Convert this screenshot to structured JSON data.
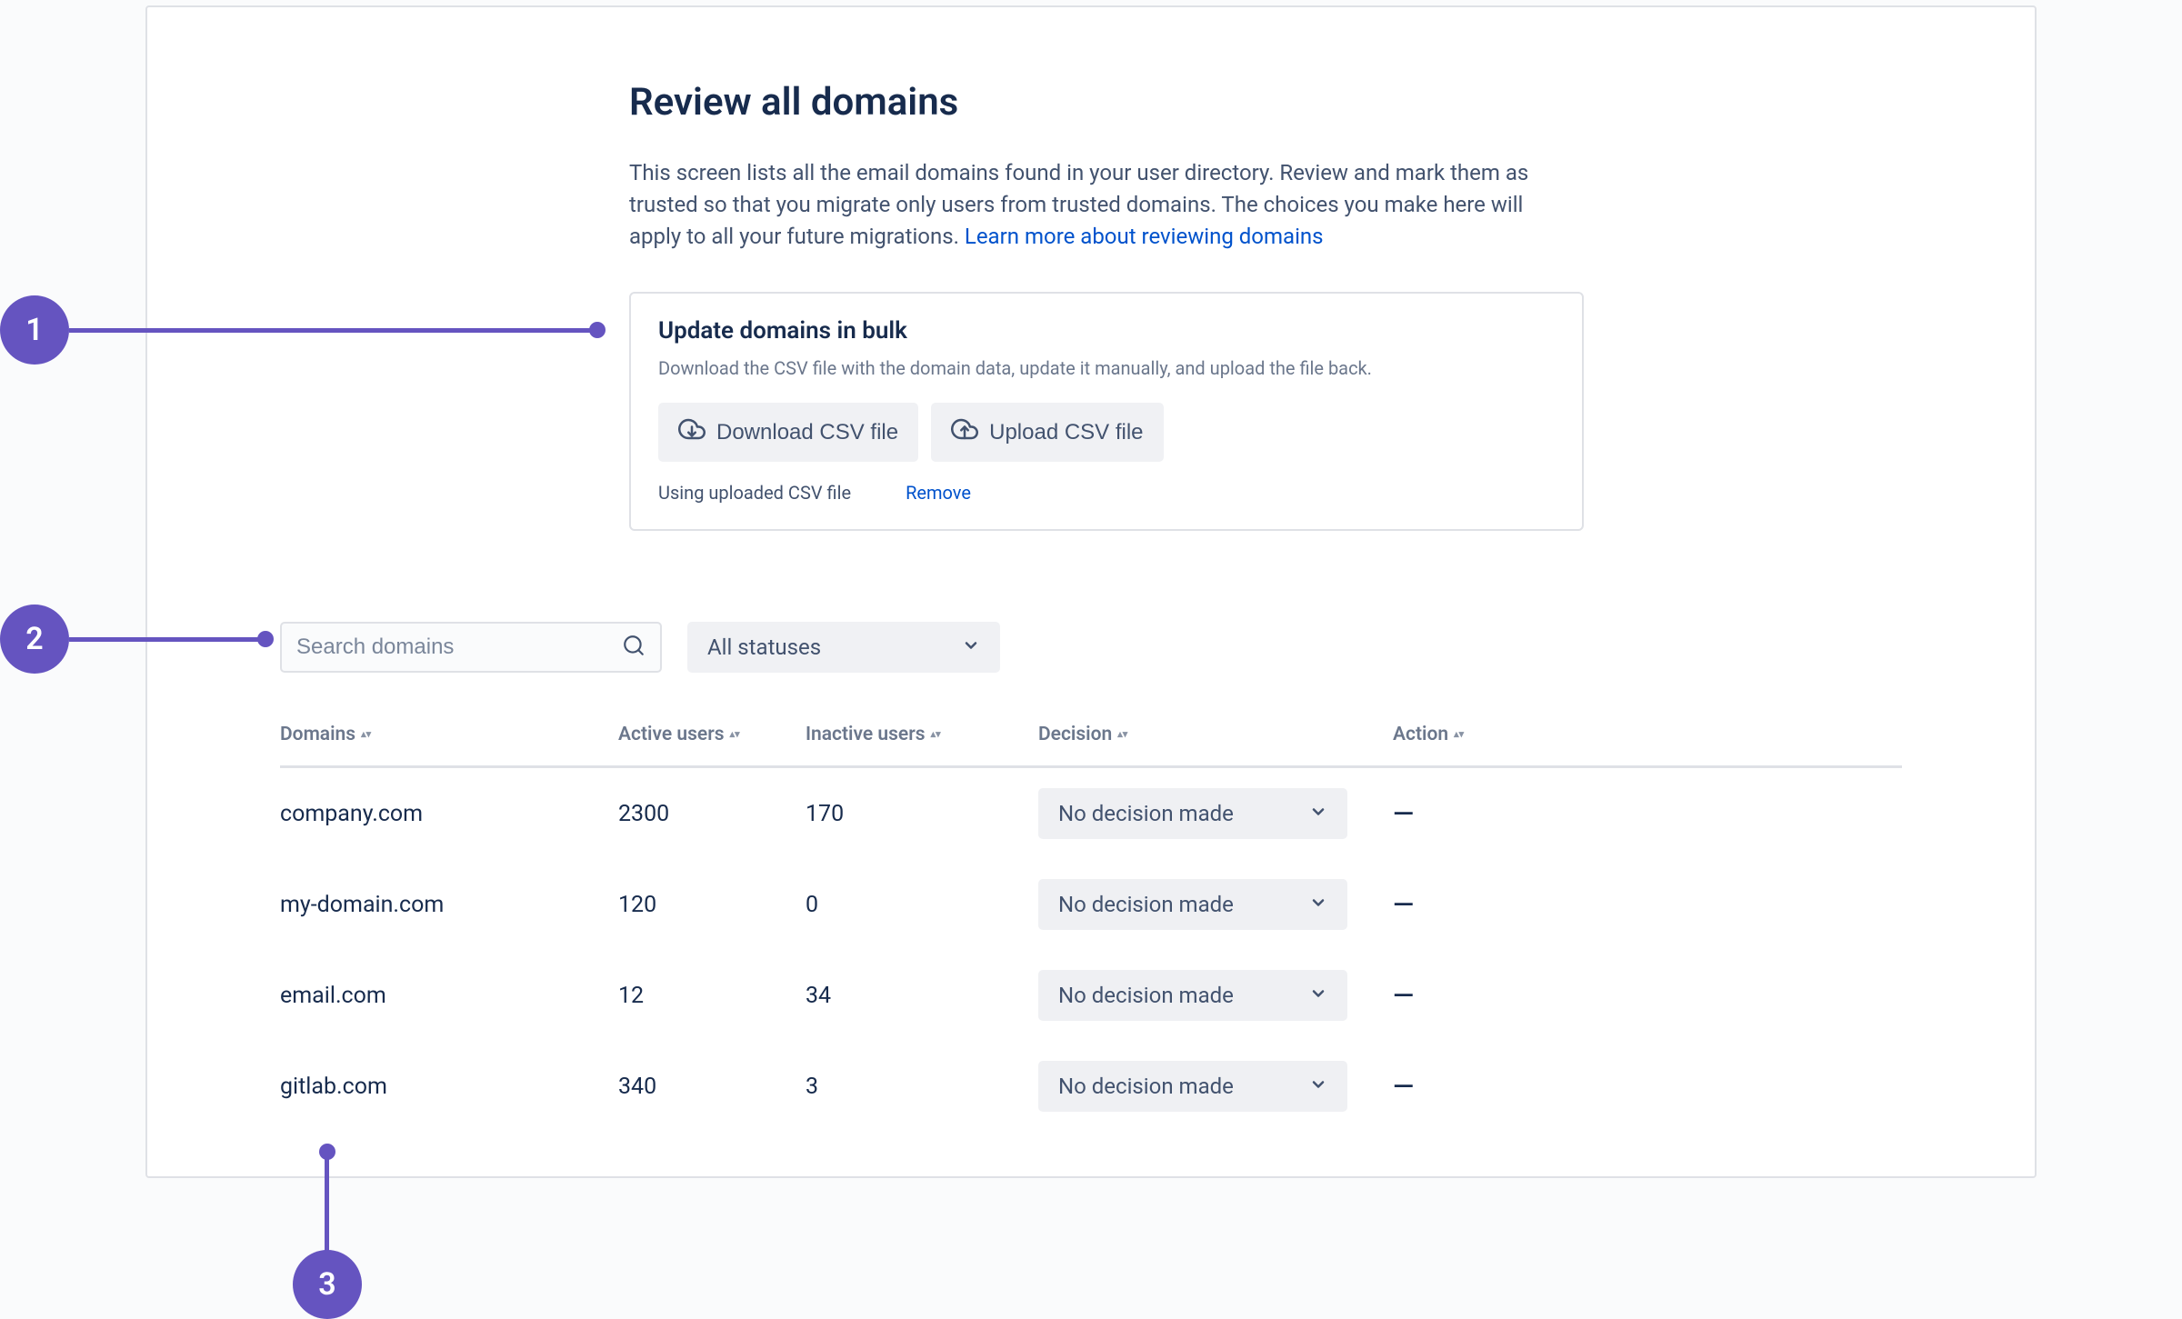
{
  "page": {
    "title": "Review all domains",
    "description_prefix": "This screen lists all the email domains found in your user directory. Review and mark them as trusted so that you migrate only users from trusted domains. The choices you make here will apply to all your future migrations. ",
    "learn_more": "Learn more about reviewing domains"
  },
  "bulk": {
    "title": "Update domains in bulk",
    "description": "Download the CSV file with the domain data, update it manually, and upload the file back.",
    "download_label": "Download CSV file",
    "upload_label": "Upload CSV file",
    "status_text": "Using uploaded CSV file",
    "remove_label": "Remove"
  },
  "filters": {
    "search_placeholder": "Search domains",
    "status_selected": "All statuses"
  },
  "table": {
    "headers": {
      "domains": "Domains",
      "active": "Active users",
      "inactive": "Inactive users",
      "decision": "Decision",
      "action": "Action"
    },
    "decision_default": "No decision made",
    "action_placeholder": "—",
    "rows": [
      {
        "domain": "company.com",
        "active": "2300",
        "inactive": "170"
      },
      {
        "domain": "my-domain.com",
        "active": "120",
        "inactive": "0"
      },
      {
        "domain": "email.com",
        "active": "12",
        "inactive": "34"
      },
      {
        "domain": "gitlab.com",
        "active": "340",
        "inactive": "3"
      }
    ]
  },
  "annotations": {
    "a1": "1",
    "a2": "2",
    "a3": "3"
  }
}
